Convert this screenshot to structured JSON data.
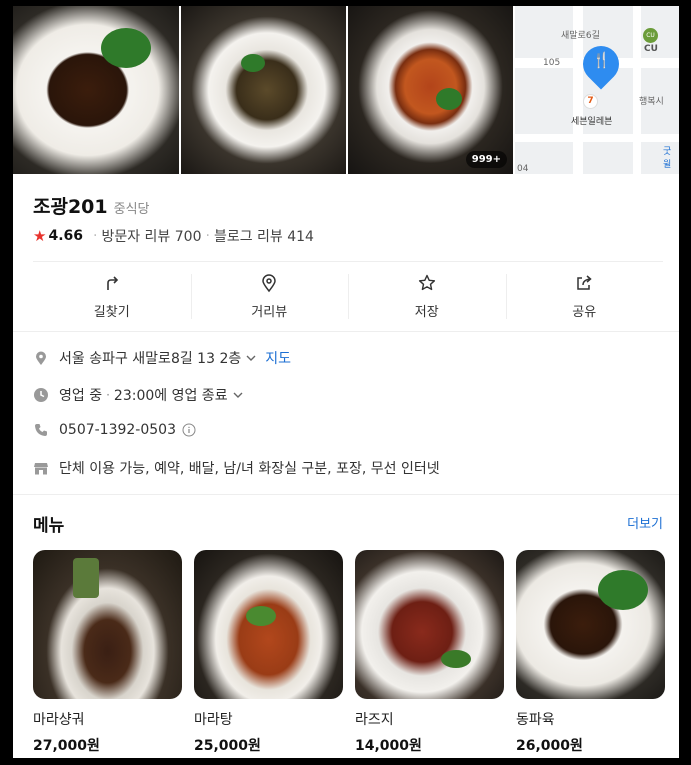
{
  "photos": {
    "count_badge": "999+"
  },
  "map": {
    "labels": [
      "새말로6길",
      "CU",
      "105",
      "행복시",
      "세븐일레븐",
      "굿윌",
      "04"
    ]
  },
  "place": {
    "name": "조광201",
    "category": "중식당",
    "rating": "4.66",
    "visitor_reviews": "방문자 리뷰 700",
    "blog_reviews": "블로그 리뷰 414"
  },
  "actions": [
    {
      "label": "길찾기",
      "icon": "directions-icon"
    },
    {
      "label": "거리뷰",
      "icon": "street-view-icon"
    },
    {
      "label": "저장",
      "icon": "star-outline-icon"
    },
    {
      "label": "공유",
      "icon": "share-icon"
    }
  ],
  "info": {
    "address": "서울 송파구 새말로8길 13 2층",
    "map_link": "지도",
    "status": "영업 중",
    "hours": "23:00에 영업 종료",
    "phone": "0507-1392-0503",
    "amenities": "단체 이용 가능, 예약, 배달, 남/녀 화장실 구분, 포장, 무선 인터넷"
  },
  "menu": {
    "title": "메뉴",
    "more": "더보기",
    "items": [
      {
        "name": "마라샹궈",
        "price": "27,000원"
      },
      {
        "name": "마라탕",
        "price": "25,000원"
      },
      {
        "name": "라즈지",
        "price": "14,000원"
      },
      {
        "name": "동파육",
        "price": "26,000원"
      }
    ]
  },
  "colors": {
    "accent": "#1c6fd3",
    "star": "#e8332d",
    "pin": "#2e8cf0"
  }
}
